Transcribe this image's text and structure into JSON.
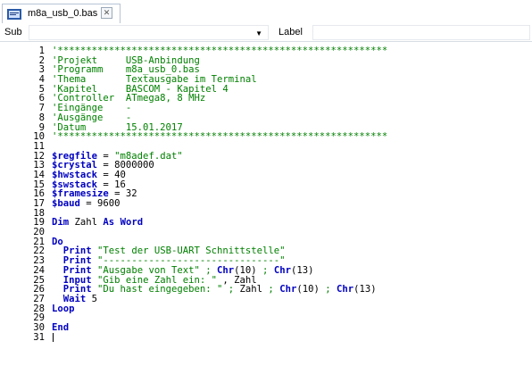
{
  "tab": {
    "title": "m8a_usb_0.bas",
    "close": "✕"
  },
  "toolbar": {
    "sub_label": "Sub",
    "label_label": "Label",
    "sub_value": "",
    "label_value": ""
  },
  "code": [
    {
      "n": "1",
      "parts": [
        {
          "c": "cmt",
          "t": "'**********************************************************"
        }
      ]
    },
    {
      "n": "2",
      "parts": [
        {
          "c": "cmt",
          "t": "'Projekt     USB-Anbindung"
        }
      ]
    },
    {
      "n": "3",
      "parts": [
        {
          "c": "cmt",
          "t": "'Programm    m8a_usb_0.bas"
        }
      ]
    },
    {
      "n": "4",
      "parts": [
        {
          "c": "cmt",
          "t": "'Thema       Textausgabe im Terminal"
        }
      ]
    },
    {
      "n": "5",
      "parts": [
        {
          "c": "cmt",
          "t": "'Kapitel     BASCOM - Kapitel 4"
        }
      ]
    },
    {
      "n": "6",
      "parts": [
        {
          "c": "cmt",
          "t": "'Controller  ATmega8, 8 MHz"
        }
      ]
    },
    {
      "n": "7",
      "parts": [
        {
          "c": "cmt",
          "t": "'Eingänge    -"
        }
      ]
    },
    {
      "n": "8",
      "parts": [
        {
          "c": "cmt",
          "t": "'Ausgänge    -"
        }
      ]
    },
    {
      "n": "9",
      "parts": [
        {
          "c": "cmt",
          "t": "'Datum       15.01.2017"
        }
      ]
    },
    {
      "n": "10",
      "parts": [
        {
          "c": "cmt",
          "t": "'**********************************************************"
        }
      ]
    },
    {
      "n": "11",
      "parts": []
    },
    {
      "n": "12",
      "parts": [
        {
          "c": "kw",
          "t": "$regfile"
        },
        {
          "c": "txt",
          "t": " = "
        },
        {
          "c": "str",
          "t": "\"m8adef.dat\""
        }
      ]
    },
    {
      "n": "13",
      "parts": [
        {
          "c": "kw",
          "t": "$crystal"
        },
        {
          "c": "txt",
          "t": " = 8000000"
        }
      ]
    },
    {
      "n": "14",
      "parts": [
        {
          "c": "kw",
          "t": "$hwstack"
        },
        {
          "c": "txt",
          "t": " = 40"
        }
      ]
    },
    {
      "n": "15",
      "parts": [
        {
          "c": "kw",
          "t": "$swstack"
        },
        {
          "c": "txt",
          "t": " = 16"
        }
      ]
    },
    {
      "n": "16",
      "parts": [
        {
          "c": "kw",
          "t": "$framesize"
        },
        {
          "c": "txt",
          "t": " = 32"
        }
      ]
    },
    {
      "n": "17",
      "parts": [
        {
          "c": "kw",
          "t": "$baud"
        },
        {
          "c": "txt",
          "t": " = 9600"
        }
      ]
    },
    {
      "n": "18",
      "parts": []
    },
    {
      "n": "19",
      "parts": [
        {
          "c": "kw",
          "t": "Dim"
        },
        {
          "c": "txt",
          "t": " Zahl "
        },
        {
          "c": "kw",
          "t": "As"
        },
        {
          "c": "txt",
          "t": " "
        },
        {
          "c": "kw",
          "t": "Word"
        }
      ]
    },
    {
      "n": "20",
      "parts": []
    },
    {
      "n": "21",
      "parts": [
        {
          "c": "kw",
          "t": "Do"
        }
      ]
    },
    {
      "n": "22",
      "parts": [
        {
          "c": "txt",
          "t": "  "
        },
        {
          "c": "kw",
          "t": "Print"
        },
        {
          "c": "txt",
          "t": " "
        },
        {
          "c": "str",
          "t": "\"Test der USB-UART Schnittstelle\""
        }
      ]
    },
    {
      "n": "23",
      "parts": [
        {
          "c": "txt",
          "t": "  "
        },
        {
          "c": "kw",
          "t": "Print"
        },
        {
          "c": "txt",
          "t": " "
        },
        {
          "c": "str",
          "t": "\"-------------------------------\""
        }
      ]
    },
    {
      "n": "24",
      "parts": [
        {
          "c": "txt",
          "t": "  "
        },
        {
          "c": "kw",
          "t": "Print"
        },
        {
          "c": "txt",
          "t": " "
        },
        {
          "c": "str",
          "t": "\"Ausgabe von Text\""
        },
        {
          "c": "str",
          "t": " ; "
        },
        {
          "c": "kw",
          "t": "Chr"
        },
        {
          "c": "txt",
          "t": "(10) "
        },
        {
          "c": "str",
          "t": ";"
        },
        {
          "c": "txt",
          "t": " "
        },
        {
          "c": "kw",
          "t": "Chr"
        },
        {
          "c": "txt",
          "t": "(13)"
        }
      ]
    },
    {
      "n": "25",
      "parts": [
        {
          "c": "txt",
          "t": "  "
        },
        {
          "c": "kw",
          "t": "Input"
        },
        {
          "c": "txt",
          "t": " "
        },
        {
          "c": "str",
          "t": "\"Gib eine Zahl ein: \""
        },
        {
          "c": "txt",
          "t": " , Zahl"
        }
      ]
    },
    {
      "n": "26",
      "parts": [
        {
          "c": "txt",
          "t": "  "
        },
        {
          "c": "kw",
          "t": "Print"
        },
        {
          "c": "txt",
          "t": " "
        },
        {
          "c": "str",
          "t": "\"Du hast eingegeben: \""
        },
        {
          "c": "str",
          "t": " ; "
        },
        {
          "c": "txt",
          "t": "Zahl "
        },
        {
          "c": "str",
          "t": ";"
        },
        {
          "c": "txt",
          "t": " "
        },
        {
          "c": "kw",
          "t": "Chr"
        },
        {
          "c": "txt",
          "t": "(10) "
        },
        {
          "c": "str",
          "t": ";"
        },
        {
          "c": "txt",
          "t": " "
        },
        {
          "c": "kw",
          "t": "Chr"
        },
        {
          "c": "txt",
          "t": "(13)"
        }
      ]
    },
    {
      "n": "27",
      "parts": [
        {
          "c": "txt",
          "t": "  "
        },
        {
          "c": "kw",
          "t": "Wait"
        },
        {
          "c": "txt",
          "t": " 5"
        }
      ]
    },
    {
      "n": "28",
      "parts": [
        {
          "c": "kw",
          "t": "Loop"
        }
      ]
    },
    {
      "n": "29",
      "parts": []
    },
    {
      "n": "30",
      "parts": [
        {
          "c": "kw",
          "t": "End"
        }
      ]
    },
    {
      "n": "31",
      "parts": []
    }
  ],
  "icons": {
    "file": "bas-file-icon",
    "close": "close-icon",
    "dropdown": "dropdown-arrow-icon"
  }
}
